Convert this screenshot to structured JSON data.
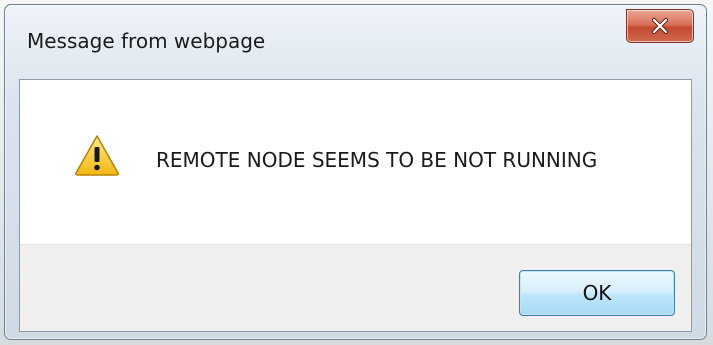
{
  "dialog": {
    "title": "Message from webpage",
    "message": "REMOTE NODE SEEMS TO BE NOT RUNNING",
    "icon": "warning-icon",
    "ok_label": "OK",
    "close_icon": "close-icon"
  },
  "colors": {
    "close_button": "#c94a32",
    "ok_button_border": "#3c7fb1",
    "warning_yellow": "#f5c518"
  }
}
